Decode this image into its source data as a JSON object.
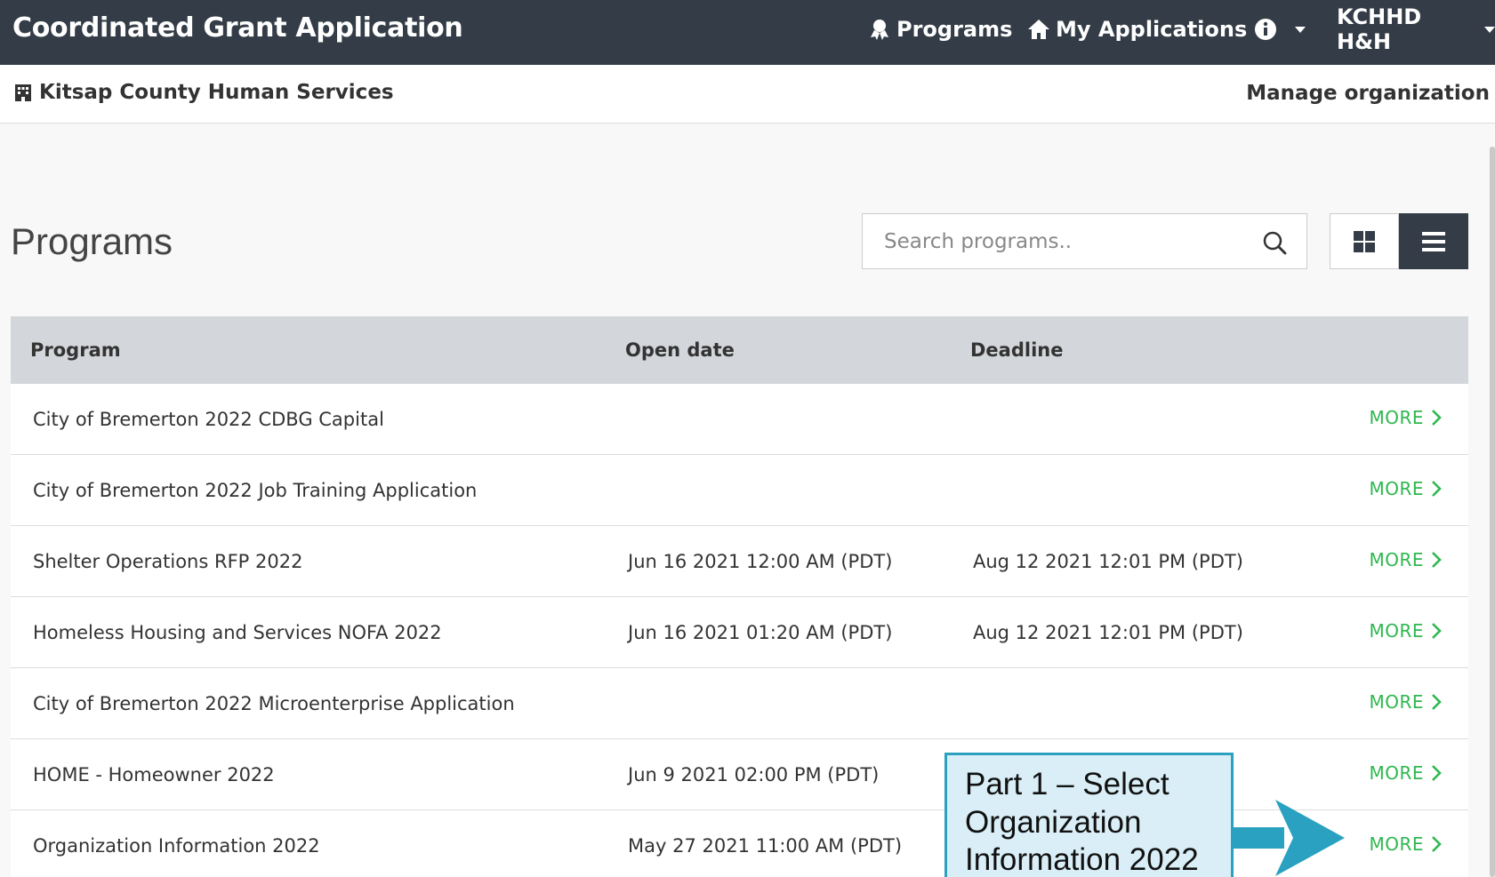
{
  "header": {
    "title": "Coordinated Grant Application",
    "nav_programs": "Programs",
    "nav_my_applications": "My Applications",
    "user": "KCHHD H&H"
  },
  "org": {
    "name": "Kitsap County Human Services",
    "manage": "Manage organization"
  },
  "page": {
    "title": "Programs",
    "search_placeholder": "Search programs.."
  },
  "table": {
    "columns": [
      "Program",
      "Open date",
      "Deadline"
    ],
    "more_label": "MORE",
    "rows": [
      {
        "program": "City of Bremerton 2022 CDBG Capital",
        "open": "",
        "deadline": ""
      },
      {
        "program": "City of Bremerton 2022 Job Training Application",
        "open": "",
        "deadline": ""
      },
      {
        "program": "Shelter Operations RFP 2022",
        "open": "Jun 16 2021 12:00 AM (PDT)",
        "deadline": "Aug 12 2021 12:01 PM (PDT)"
      },
      {
        "program": "Homeless Housing and Services NOFA 2022",
        "open": "Jun 16 2021 01:20 AM (PDT)",
        "deadline": "Aug 12 2021 12:01 PM (PDT)"
      },
      {
        "program": "City of Bremerton 2022 Microenterprise Application",
        "open": "",
        "deadline": ""
      },
      {
        "program": "HOME - Homeowner 2022",
        "open": "Jun 9 2021 02:00 PM (PDT)",
        "deadline": ""
      },
      {
        "program": "Organization Information 2022",
        "open": "May 27 2021 11:00 AM (PDT)",
        "deadline": ""
      }
    ]
  },
  "callout": {
    "text": "Part 1 – Select Organization Information 2022"
  },
  "colors": {
    "header_bg": "#343d47",
    "more_green": "#2eb84f",
    "callout_border": "#2aa1c0",
    "callout_bg": "#d9eef6"
  }
}
